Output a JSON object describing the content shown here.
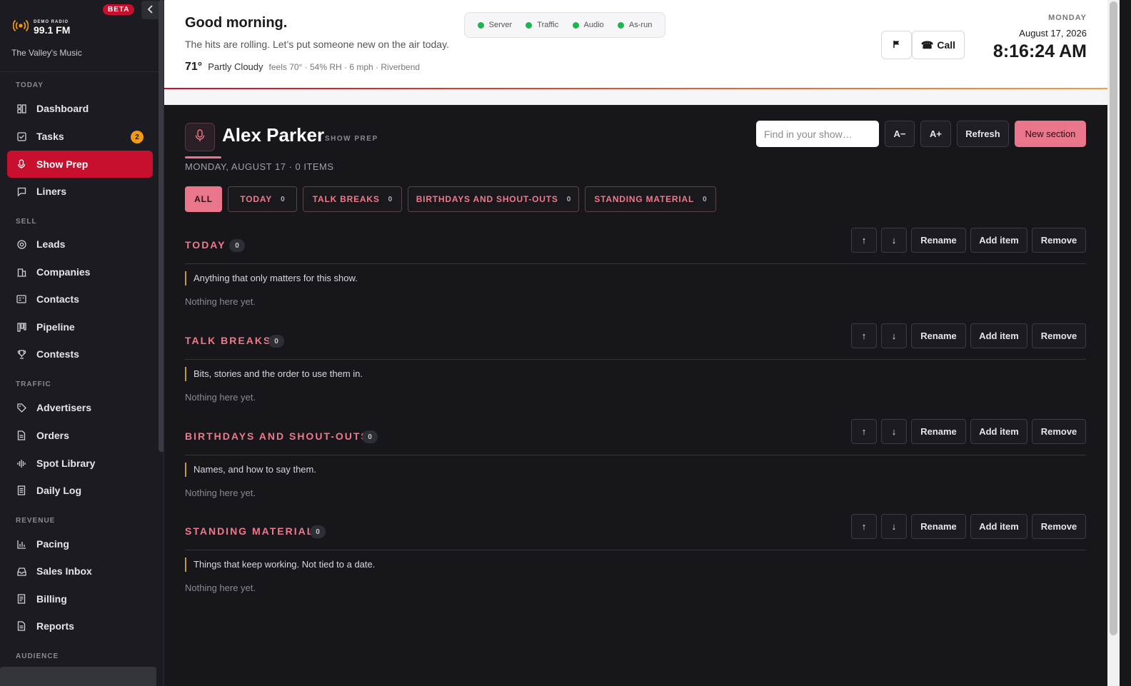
{
  "brand": {
    "small": "DEMO RADIO",
    "freq": "99.1 FM",
    "tagline": "The Valley's Music",
    "beta": "BETA"
  },
  "nav": {
    "groups": [
      {
        "label": "TODAY"
      },
      {
        "label": "SELL"
      },
      {
        "label": "TRAFFIC"
      },
      {
        "label": "REVENUE"
      },
      {
        "label": "AUDIENCE"
      }
    ],
    "items": [
      {
        "label": "Dashboard",
        "icon": "dashboard-icon"
      },
      {
        "label": "Tasks",
        "icon": "checkbox-icon",
        "badge": "2"
      },
      {
        "label": "Show Prep",
        "icon": "microphone-icon",
        "active": true
      },
      {
        "label": "Liners",
        "icon": "chat-icon"
      },
      {
        "label": "Leads",
        "icon": "target-icon"
      },
      {
        "label": "Companies",
        "icon": "building-icon"
      },
      {
        "label": "Contacts",
        "icon": "contact-card-icon"
      },
      {
        "label": "Pipeline",
        "icon": "columns-icon"
      },
      {
        "label": "Contests",
        "icon": "trophy-icon"
      },
      {
        "label": "Advertisers",
        "icon": "tag-icon"
      },
      {
        "label": "Orders",
        "icon": "document-icon"
      },
      {
        "label": "Spot Library",
        "icon": "waveform-icon"
      },
      {
        "label": "Daily Log",
        "icon": "log-icon"
      },
      {
        "label": "Pacing",
        "icon": "bar-chart-icon"
      },
      {
        "label": "Sales Inbox",
        "icon": "inbox-icon"
      },
      {
        "label": "Billing",
        "icon": "receipt-icon"
      },
      {
        "label": "Reports",
        "icon": "report-icon"
      }
    ]
  },
  "header": {
    "greeting": "Good morning.",
    "subtitle": "The hits are rolling. Let’s put someone new on the air today.",
    "weather": {
      "temp": "71°",
      "condition": "Partly Cloudy",
      "details": "feels 70° · 54% RH · 6 mph · Riverbend"
    },
    "status": [
      {
        "label": "Server",
        "color": "#1db452"
      },
      {
        "label": "Traffic",
        "color": "#1db452"
      },
      {
        "label": "Audio",
        "color": "#1db452"
      },
      {
        "label": "As-run",
        "color": "#1db452"
      }
    ],
    "call_label": "Call",
    "clock": {
      "day": "MONDAY",
      "date": "August 17, 2026",
      "time": "8:16:24 AM"
    }
  },
  "main": {
    "host": "Alex Parker",
    "host_tag": "SHOW PREP",
    "meta": "MONDAY, AUGUST 17 · 0 ITEMS",
    "search_placeholder": "Find in your show…",
    "buttons": {
      "font_down": "A−",
      "font_up": "A+",
      "refresh": "Refresh",
      "new_section": "New section"
    },
    "filters": [
      {
        "label": "ALL",
        "count": ""
      },
      {
        "label": "TODAY",
        "count": "0"
      },
      {
        "label": "TALK BREAKS",
        "count": "0"
      },
      {
        "label": "BIRTHDAYS AND SHOUT-OUTS",
        "count": "0"
      },
      {
        "label": "STANDING MATERIAL",
        "count": "0"
      }
    ],
    "section_actions": {
      "up": "↑",
      "down": "↓",
      "rename": "Rename",
      "add_item": "Add item",
      "remove": "Remove"
    },
    "sections": [
      {
        "title": "TODAY",
        "count": "0",
        "desc": "Anything that only matters for this show.",
        "empty": "Nothing here yet."
      },
      {
        "title": "TALK BREAKS",
        "count": "0",
        "desc": "Bits, stories and the order to use them in.",
        "empty": "Nothing here yet."
      },
      {
        "title": "BIRTHDAYS AND SHOUT-OUTS",
        "count": "0",
        "desc": "Names, and how to say them.",
        "empty": "Nothing here yet."
      },
      {
        "title": "STANDING MATERIAL",
        "count": "0",
        "desc": "Things that keep working. Not tied to a date.",
        "empty": "Nothing here yet."
      }
    ]
  },
  "colors": {
    "accent": "#c8102e",
    "accent_soft": "#e9768a",
    "badge": "#f29a12",
    "status_ok": "#1db452"
  }
}
